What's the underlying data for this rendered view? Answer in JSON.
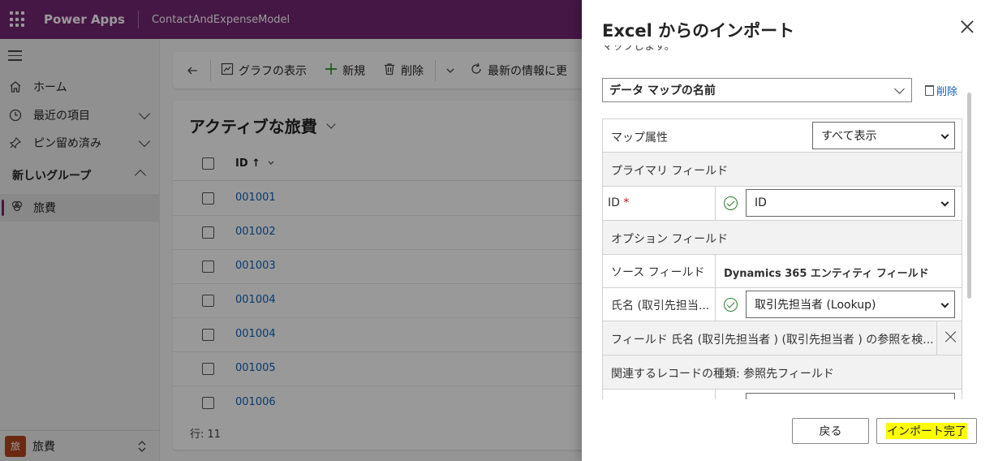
{
  "topbar": {
    "brand": "Power Apps",
    "app_name": "ContactAndExpenseModel"
  },
  "sidebar": {
    "items": [
      {
        "label": "ホーム",
        "icon": "home-icon"
      },
      {
        "label": "最近の項目",
        "icon": "clock-icon"
      },
      {
        "label": "ピン留め済み",
        "icon": "pin-icon"
      }
    ],
    "group_label": "新しいグループ",
    "active_item": {
      "label": "旅費",
      "icon": "expense-icon"
    },
    "area": {
      "badge": "旅",
      "label": "旅費"
    }
  },
  "commandbar": {
    "show_chart": "グラフの表示",
    "new": "新規",
    "delete": "削除",
    "refresh": "最新の情報に更"
  },
  "grid": {
    "view_title": "アクティブな旅費",
    "column_id": "ID ↑",
    "rows": [
      "001001",
      "001002",
      "001003",
      "001004",
      "001004",
      "001005",
      "001006"
    ],
    "row_count": "行: 11"
  },
  "import_panel": {
    "title": "Excel からのインポート",
    "cut_text": "マップします。",
    "data_map_name": "データ マップの名前",
    "delete_link": "削除",
    "map_attribute_label": "マップ属性",
    "map_attribute_value": "すべて表示",
    "primary_fields_header": "プライマリ フィールド",
    "id_label": "ID",
    "id_required": "*",
    "id_value": "ID",
    "optional_fields_header": "オプション フィールド",
    "source_field_header": "ソース フィールド",
    "dynamics_field_header": "Dynamics 365 エンティティ フィールド",
    "name_label": "氏名 (取引先担当...",
    "name_value": "取引先担当者 (Lookup)",
    "warning_text": "フィールド 氏名 (取引先担当者 ) (取引先担当者 ) の参照を検...",
    "related_record_text": "関連するレコードの種類: 参照先フィールド",
    "back_button": "戻る",
    "import_button": "インポート完了"
  },
  "colors": {
    "brand": "#742774",
    "link": "#1160b7",
    "highlight": "#ffff00",
    "area_badge": "#b4451f"
  }
}
